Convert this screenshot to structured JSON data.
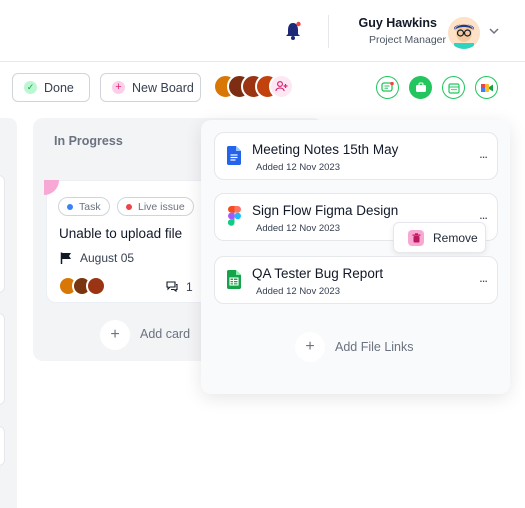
{
  "header": {
    "user_name": "Guy Hawkins",
    "user_role": "Project Manager"
  },
  "toolbar": {
    "done_label": "Done",
    "new_board_label": "New Board"
  },
  "column": {
    "title": "In Progress",
    "card": {
      "tags": [
        "Task",
        "Live issue"
      ],
      "title": "Unable to upload file",
      "due_date": "August 05",
      "comment_count": "1"
    },
    "add_card_label": "Add card"
  },
  "files_panel": {
    "files": [
      {
        "name": "Meeting Notes 15th May",
        "date": "Added 12 Nov 2023",
        "icon": "google-docs-icon"
      },
      {
        "name": "Sign Flow Figma Design",
        "date": "Added 12 Nov 2023",
        "icon": "figma-icon"
      },
      {
        "name": "QA Tester Bug Report",
        "date": "Added 12 Nov 2023",
        "icon": "google-sheets-icon"
      }
    ],
    "menu_more": "...",
    "remove_label": "Remove",
    "add_links_label": "Add File Links"
  },
  "colors": {
    "accent_green": "#22c55e",
    "tag_task": "#3b82f6",
    "tag_live": "#ef4444",
    "docs_blue": "#2563eb",
    "sheets_green": "#16a34a",
    "remove_pink": "#f9a8d4"
  }
}
